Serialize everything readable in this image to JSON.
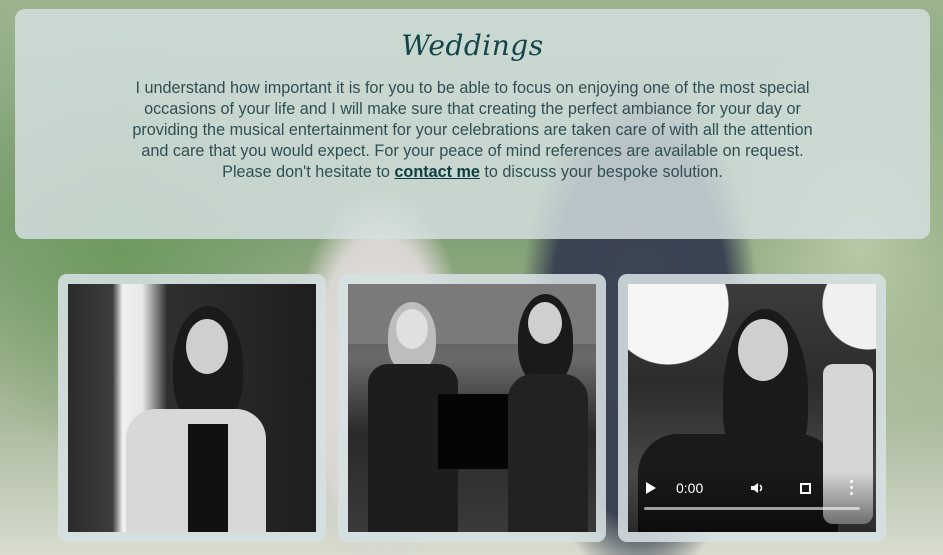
{
  "section": {
    "title": "Weddings",
    "intro_before_link": "I understand how important it is for you to be able to focus on enjoying one of the most special occasions of your life and I will make sure that creating the perfect ambiance for your day or providing the musical entertainment for your celebrations are taken care of with all the attention and care that you would expect. For your peace of mind references are available on request. Please don't hesitate to ",
    "link_text": "contact me",
    "intro_after_link": " to discuss your bespoke solution."
  },
  "video": {
    "time": "0:00",
    "progress": 0
  },
  "icons": {
    "play": "play-icon",
    "volume": "volume-icon",
    "fullscreen": "fullscreen-icon",
    "more": "more-options-icon"
  }
}
